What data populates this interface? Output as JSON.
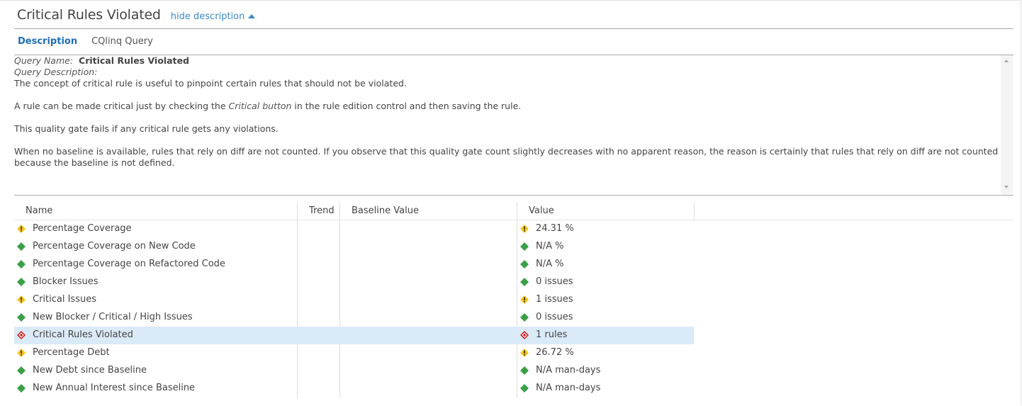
{
  "header": {
    "title": "Critical Rules Violated",
    "toggle_label": "hide description"
  },
  "tabs": [
    {
      "label": "Description",
      "active": true
    },
    {
      "label": "CQlinq Query",
      "active": false
    }
  ],
  "description": {
    "query_name_label": "Query Name:",
    "query_name": "Critical Rules Violated",
    "query_description_label": "Query Description:",
    "para1": "The concept of critical rule is useful to pinpoint certain rules that should not be violated.",
    "para2_before": "A rule can be made critical just by checking the ",
    "para2_italic": "Critical button",
    "para2_after": " in the rule edition control and then saving the rule.",
    "para3": "This quality gate fails if any critical rule gets any violations.",
    "para4": "When no baseline is available, rules that rely on diff are not counted. If you observe that this quality gate count slightly decreases with no apparent reason, the reason is certainly that rules that rely on diff are not counted because the baseline is not defined."
  },
  "table": {
    "columns": {
      "name": "Name",
      "trend": "Trend",
      "baseline": "Baseline Value",
      "value": "Value"
    },
    "rows": [
      {
        "name": "Percentage Coverage",
        "status": "warning",
        "value": "24.31 %"
      },
      {
        "name": "Percentage Coverage on New Code",
        "status": "ok",
        "value": "N/A %"
      },
      {
        "name": "Percentage Coverage on Refactored Code",
        "status": "ok",
        "value": "N/A %"
      },
      {
        "name": "Blocker Issues",
        "status": "ok",
        "value": "0 issues"
      },
      {
        "name": "Critical Issues",
        "status": "warning",
        "value": "1 issues"
      },
      {
        "name": "New Blocker / Critical / High Issues",
        "status": "ok",
        "value": "0 issues"
      },
      {
        "name": "Critical Rules Violated",
        "status": "fail",
        "value": "1 rules",
        "selected": true
      },
      {
        "name": "Percentage Debt",
        "status": "warning",
        "value": "26.72 %"
      },
      {
        "name": "New Debt since Baseline",
        "status": "ok",
        "value": "N/A man-days"
      },
      {
        "name": "New Annual Interest since Baseline",
        "status": "ok",
        "value": "N/A man-days"
      }
    ]
  },
  "colors": {
    "ok": "#3aa046",
    "warning": "#f5c518",
    "fail": "#d42020",
    "link": "#3b89c9",
    "selected_row": "#dbeaf7"
  }
}
